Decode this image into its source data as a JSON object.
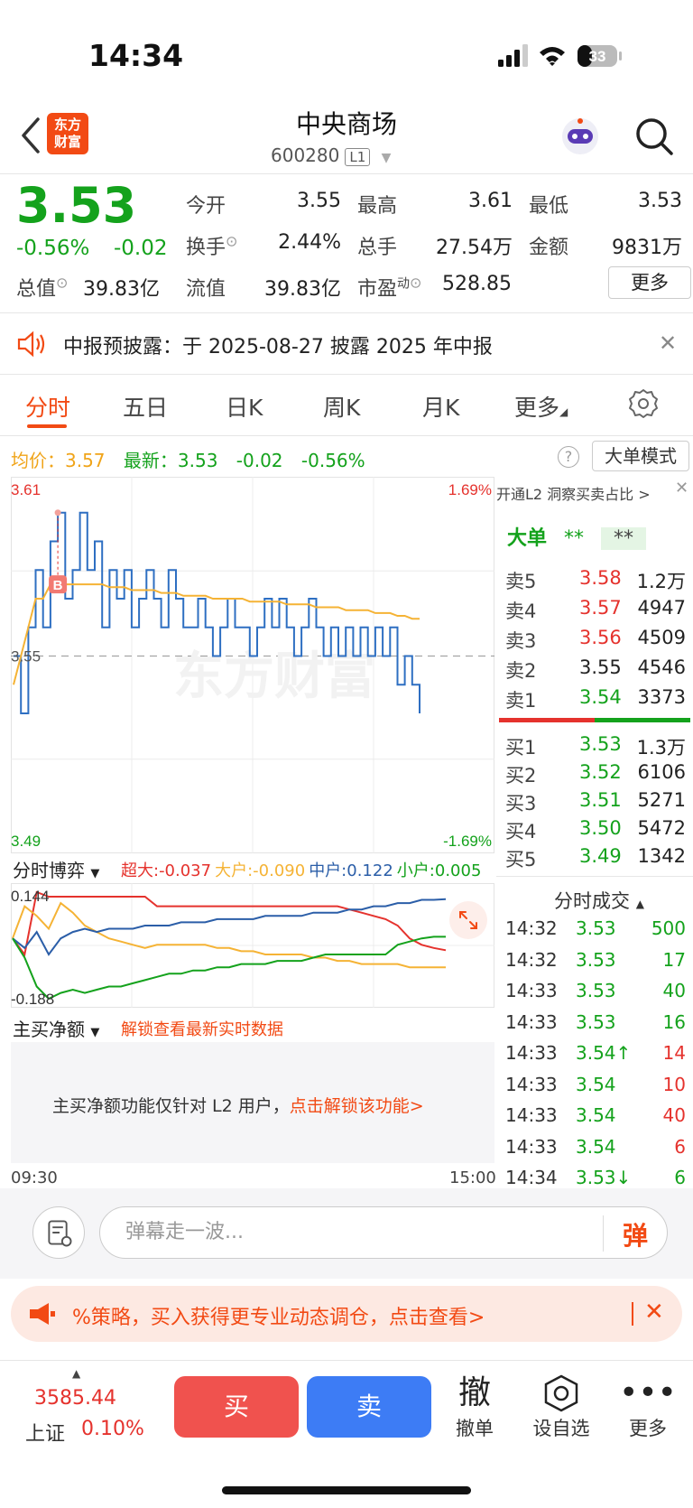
{
  "status": {
    "time": "14:34",
    "battery": "33"
  },
  "header": {
    "app_logo": "东方\n财富",
    "stock_name": "中央商场",
    "stock_code": "600280",
    "level": "L1"
  },
  "quote": {
    "price": "3.53",
    "change_pct": "-0.56%",
    "change_val": "-0.02",
    "fields": {
      "open_label": "今开",
      "open": "3.55",
      "high_label": "最高",
      "high": "3.61",
      "low_label": "最低",
      "low": "3.53",
      "turnover_label": "换手",
      "turnover": "2.44%",
      "volume_label": "总手",
      "volume": "27.54万",
      "amount_label": "金额",
      "amount": "9831万",
      "total_cap_label": "总值",
      "total_cap": "39.83亿",
      "float_cap_label": "流值",
      "float_cap": "39.83亿",
      "pe_label": "市盈",
      "pe_sup": "动",
      "pe": "528.85"
    },
    "more_label": "更多"
  },
  "notice": {
    "text": "中报预披露：于 2025-08-27 披露 2025 年中报"
  },
  "tabs": [
    "分时",
    "五日",
    "日K",
    "周K",
    "月K",
    "更多"
  ],
  "info_line": {
    "avg_label": "均价：",
    "avg": "3.57",
    "latest_label": "最新：",
    "latest": "3.53",
    "change": "-0.02",
    "pct": "-0.56%",
    "help": "?",
    "mode_button": "大单模式"
  },
  "chart_data": [
    {
      "type": "line",
      "name": "分时",
      "ylim": [
        3.49,
        3.61
      ],
      "y_ticks": [
        "3.61",
        "3.55",
        "3.49"
      ],
      "pct_ticks": [
        "1.69%",
        "-1.69%"
      ],
      "x_labels": [
        "09:30",
        "15:00"
      ],
      "watermark": "东方财富",
      "marker": "B",
      "series": [
        {
          "name": "价格",
          "color": "#2e6fc2",
          "values": [
            3.55,
            3.53,
            3.56,
            3.58,
            3.56,
            3.59,
            3.6,
            3.57,
            3.58,
            3.6,
            3.58,
            3.59,
            3.56,
            3.58,
            3.57,
            3.58,
            3.56,
            3.57,
            3.58,
            3.57,
            3.56,
            3.58,
            3.57,
            3.56,
            3.56,
            3.57,
            3.56,
            3.55,
            3.56,
            3.57,
            3.56,
            3.56,
            3.55,
            3.56,
            3.57,
            3.56,
            3.57,
            3.56,
            3.55,
            3.56,
            3.57,
            3.56,
            3.55,
            3.56,
            3.55,
            3.56,
            3.55,
            3.56,
            3.55,
            3.56,
            3.55,
            3.56,
            3.54,
            3.55,
            3.54,
            3.53
          ]
        },
        {
          "name": "均价",
          "color": "#f5b335",
          "values": [
            3.54,
            3.55,
            3.56,
            3.57,
            3.57,
            3.575,
            3.575,
            3.575,
            3.575,
            3.575,
            3.575,
            3.575,
            3.575,
            3.574,
            3.574,
            3.574,
            3.573,
            3.573,
            3.573,
            3.573,
            3.572,
            3.572,
            3.572,
            3.571,
            3.571,
            3.571,
            3.571,
            3.57,
            3.57,
            3.57,
            3.57,
            3.57,
            3.569,
            3.569,
            3.569,
            3.569,
            3.569,
            3.568,
            3.568,
            3.568,
            3.568,
            3.567,
            3.567,
            3.567,
            3.567,
            3.566,
            3.566,
            3.566,
            3.566,
            3.565,
            3.565,
            3.565,
            3.564,
            3.564,
            3.563,
            3.563
          ]
        }
      ]
    },
    {
      "type": "line",
      "name": "分时博弈",
      "ylim": [
        -0.188,
        0.144
      ],
      "y_ticks": [
        "0.144",
        "-0.188"
      ],
      "series": [
        {
          "name": "超大",
          "value": "-0.037",
          "color": "#e5322d",
          "values": [
            0.0,
            -0.05,
            0.144,
            0.13,
            0.13,
            0.13,
            0.13,
            0.13,
            0.13,
            0.13,
            0.13,
            0.13,
            0.1,
            0.1,
            0.1,
            0.1,
            0.1,
            0.1,
            0.1,
            0.1,
            0.1,
            0.1,
            0.1,
            0.1,
            0.1,
            0.1,
            0.1,
            0.1,
            0.09,
            0.08,
            0.07,
            0.06,
            0.04,
            0.0,
            -0.02,
            -0.03,
            -0.037
          ]
        },
        {
          "name": "大户",
          "value": "-0.090",
          "color": "#f5b335",
          "values": [
            0.0,
            0.1,
            0.07,
            0.03,
            0.11,
            0.08,
            0.04,
            0.02,
            0.0,
            -0.01,
            -0.02,
            -0.03,
            -0.02,
            -0.02,
            -0.02,
            -0.02,
            -0.02,
            -0.03,
            -0.03,
            -0.04,
            -0.04,
            -0.05,
            -0.05,
            -0.05,
            -0.05,
            -0.06,
            -0.06,
            -0.07,
            -0.07,
            -0.08,
            -0.08,
            -0.08,
            -0.08,
            -0.09,
            -0.09,
            -0.09,
            -0.09
          ]
        },
        {
          "name": "中户",
          "value": "0.122",
          "color": "#2b5ea8",
          "values": [
            0.0,
            -0.03,
            0.02,
            -0.05,
            0.0,
            0.02,
            0.03,
            0.02,
            0.03,
            0.03,
            0.03,
            0.04,
            0.04,
            0.04,
            0.05,
            0.05,
            0.05,
            0.06,
            0.06,
            0.06,
            0.06,
            0.07,
            0.07,
            0.07,
            0.07,
            0.08,
            0.08,
            0.08,
            0.09,
            0.09,
            0.1,
            0.1,
            0.11,
            0.11,
            0.12,
            0.12,
            0.122
          ]
        },
        {
          "name": "小户",
          "value": "0.005",
          "color": "#14a21c",
          "values": [
            0.0,
            -0.06,
            -0.15,
            -0.188,
            -0.17,
            -0.16,
            -0.17,
            -0.16,
            -0.15,
            -0.15,
            -0.14,
            -0.13,
            -0.12,
            -0.11,
            -0.11,
            -0.1,
            -0.1,
            -0.09,
            -0.09,
            -0.08,
            -0.08,
            -0.08,
            -0.07,
            -0.07,
            -0.07,
            -0.06,
            -0.05,
            -0.05,
            -0.05,
            -0.05,
            -0.05,
            -0.05,
            -0.02,
            -0.01,
            0.0,
            0.005,
            0.005
          ]
        }
      ]
    }
  ],
  "order_book": {
    "header": "开通L2 洞察买卖占比 >",
    "big_order_label": "大单",
    "big_order_val1": "**",
    "big_order_val2": "**",
    "asks": [
      {
        "label": "卖5",
        "price": "3.58",
        "vol": "1.2万",
        "color": "#e5322d"
      },
      {
        "label": "卖4",
        "price": "3.57",
        "vol": "4947",
        "color": "#e5322d"
      },
      {
        "label": "卖3",
        "price": "3.56",
        "vol": "4509",
        "color": "#e5322d"
      },
      {
        "label": "卖2",
        "price": "3.55",
        "vol": "4546",
        "color": "#222222"
      },
      {
        "label": "卖1",
        "price": "3.54",
        "vol": "3373",
        "color": "#14a21c"
      }
    ],
    "bids": [
      {
        "label": "买1",
        "price": "3.53",
        "vol": "1.3万",
        "color": "#14a21c"
      },
      {
        "label": "买2",
        "price": "3.52",
        "vol": "6106",
        "color": "#14a21c"
      },
      {
        "label": "买3",
        "price": "3.51",
        "vol": "5271",
        "color": "#14a21c"
      },
      {
        "label": "买4",
        "price": "3.50",
        "vol": "5472",
        "color": "#14a21c"
      },
      {
        "label": "买5",
        "price": "3.49",
        "vol": "1342",
        "color": "#14a21c"
      }
    ],
    "buy_ratio": 0.5
  },
  "game": {
    "label": "分时博弈"
  },
  "net_buy": {
    "label": "主买净额",
    "unlock_link": "解锁查看最新实时数据",
    "msg": "主买净额功能仅针对 L2 用户，",
    "msg_link": "点击解锁该功能>"
  },
  "trades": {
    "title": "分时成交",
    "rows": [
      {
        "time": "14:32",
        "price": "3.53",
        "vol": "500",
        "pc": "#14a21c",
        "vc": "#14a21c"
      },
      {
        "time": "14:32",
        "price": "3.53",
        "vol": "17",
        "pc": "#14a21c",
        "vc": "#14a21c"
      },
      {
        "time": "14:33",
        "price": "3.53",
        "vol": "40",
        "pc": "#14a21c",
        "vc": "#14a21c"
      },
      {
        "time": "14:33",
        "price": "3.53",
        "vol": "16",
        "pc": "#14a21c",
        "vc": "#14a21c"
      },
      {
        "time": "14:33",
        "price": "3.54↑",
        "vol": "14",
        "pc": "#14a21c",
        "vc": "#e5322d"
      },
      {
        "time": "14:33",
        "price": "3.54",
        "vol": "10",
        "pc": "#14a21c",
        "vc": "#e5322d"
      },
      {
        "time": "14:33",
        "price": "3.54",
        "vol": "40",
        "pc": "#14a21c",
        "vc": "#e5322d"
      },
      {
        "time": "14:33",
        "price": "3.54",
        "vol": "6",
        "pc": "#14a21c",
        "vc": "#e5322d"
      },
      {
        "time": "14:34",
        "price": "3.53↓",
        "vol": "6",
        "pc": "#14a21c",
        "vc": "#14a21c"
      }
    ]
  },
  "danmu": {
    "placeholder": "弹幕走一波...",
    "icon": "弹"
  },
  "promo": {
    "text": "%策略，买入获得更专业动态调仓，点击查看>"
  },
  "bottom": {
    "index_val": "3585.44",
    "index_name": "上证",
    "index_pct": "0.10%",
    "buy": "买",
    "sell": "卖",
    "cancel_icon": "撤",
    "cancel_label": "撤单",
    "watch_label": "设自选",
    "more_label": "更多"
  }
}
